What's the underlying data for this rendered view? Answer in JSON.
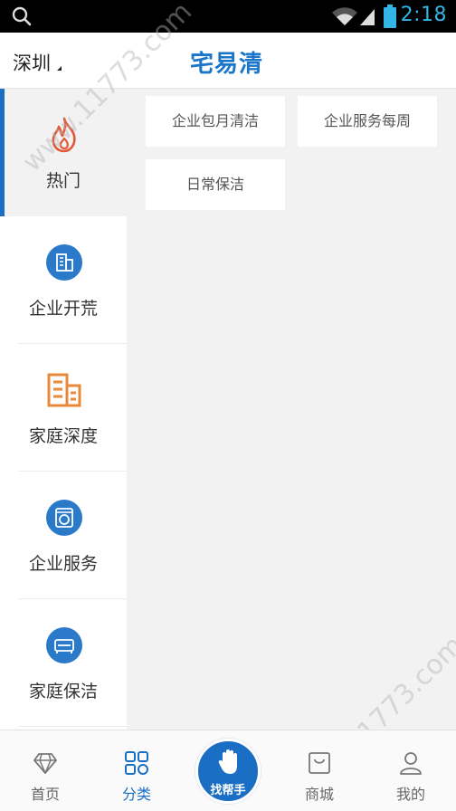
{
  "status_bar": {
    "time": "2:18",
    "icons": [
      "search-icon",
      "wifi-icon",
      "signal-icon",
      "battery-icon"
    ]
  },
  "header": {
    "city": "深圳",
    "logo": "宅易清"
  },
  "sidebar": {
    "items": [
      {
        "label": "热门",
        "icon": "flame-icon",
        "active": true
      },
      {
        "label": "企业开荒",
        "icon": "building-icon"
      },
      {
        "label": "家庭深度",
        "icon": "apartment-icon"
      },
      {
        "label": "企业服务",
        "icon": "washing-machine-icon"
      },
      {
        "label": "家庭保洁",
        "icon": "sofa-icon"
      }
    ]
  },
  "content": {
    "tags": [
      "企业包月清洁",
      "企业服务每周",
      "日常保洁"
    ]
  },
  "bottom_nav": {
    "items": [
      {
        "label": "首页",
        "icon": "diamond-icon"
      },
      {
        "label": "分类",
        "icon": "grid-icon",
        "active": true
      },
      {
        "label": "商城",
        "icon": "shop-icon"
      },
      {
        "label": "我的",
        "icon": "user-icon"
      }
    ],
    "center": {
      "label": "找帮手",
      "icon": "hand-icon"
    }
  },
  "watermark": "www.11773.com",
  "colors": {
    "brand": "#1a6fc4",
    "accent_orange": "#e8883a",
    "flame": "#e05a3a"
  }
}
